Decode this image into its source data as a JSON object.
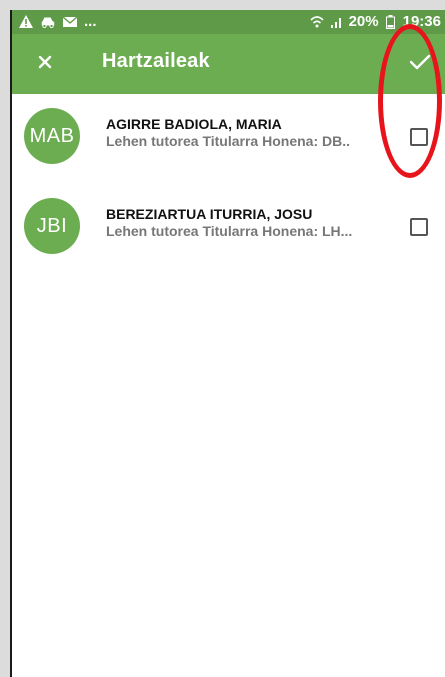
{
  "status_bar": {
    "left_icons": [
      "warning-icon",
      "car-icon",
      "mail-icon"
    ],
    "ellipsis": "...",
    "battery": "20%",
    "time": "19:36",
    "right_icons": [
      "wifi-icon",
      "signal-icon",
      "battery-icon"
    ]
  },
  "toolbar": {
    "title": "Hartzaileak",
    "close_icon": "close-icon",
    "confirm_icon": "check-icon"
  },
  "recipients": [
    {
      "initials": "MAB",
      "name": "AGIRRE BADIOLA, MARIA",
      "detail": "Lehen tutorea Titularra Honena: DB..",
      "checked": false
    },
    {
      "initials": "JBI",
      "name": "BEREZIARTUA ITURRIA, JOSU",
      "detail": "Lehen tutorea Titularra Honena: LH...",
      "checked": false
    }
  ],
  "colors": {
    "status_bar": "#5e9a47",
    "toolbar": "#6dad52",
    "avatar": "#6dad52",
    "annotation": "#e8141c"
  }
}
